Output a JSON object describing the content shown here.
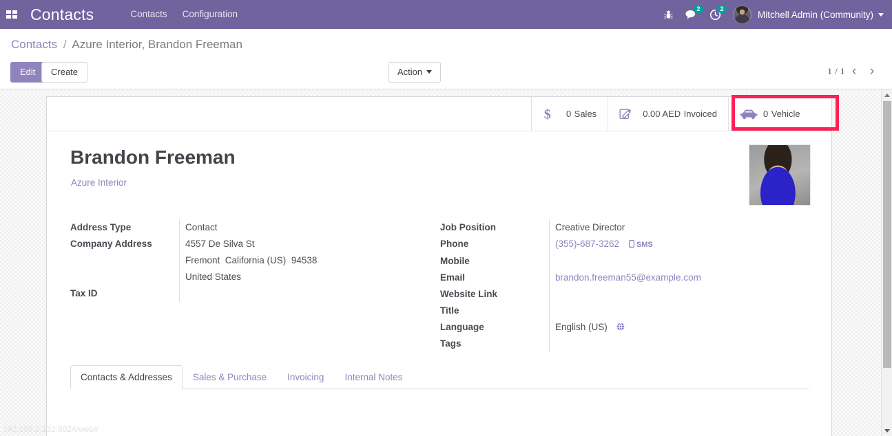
{
  "navbar": {
    "apps_icon": "apps-grid-icon",
    "brand": "Contacts",
    "menus": [
      {
        "label": "Contacts"
      },
      {
        "label": "Configuration"
      }
    ],
    "systray": [
      {
        "name": "debug-bug-icon",
        "badge": ""
      },
      {
        "name": "messages-icon",
        "badge": "2"
      },
      {
        "name": "activities-clock-icon",
        "badge": "2"
      }
    ],
    "user_name": "Mitchell Admin (Community)",
    "brand_color": "#71639e",
    "badge_color": "#00a09d"
  },
  "control_panel": {
    "breadcrumb": {
      "root": "Contacts",
      "separator": "/",
      "current": "Azure Interior, Brandon Freeman"
    },
    "buttons": {
      "edit": "Edit",
      "create": "Create",
      "action": "Action"
    },
    "pager": {
      "value": "1 / 1",
      "prev_icon": "chevron-left-icon",
      "next_icon": "chevron-right-icon"
    }
  },
  "stat_buttons": [
    {
      "icon": "dollar-sign-icon",
      "value": "0",
      "label": "Sales",
      "highlighted": false
    },
    {
      "icon": "pencil-invoice-icon",
      "value": "0.00 AED",
      "label": "Invoiced",
      "highlighted": false
    },
    {
      "icon": "car-icon",
      "value": "0",
      "label": "Vehicle",
      "highlighted": true
    }
  ],
  "highlight": {
    "color": "#fb2056"
  },
  "record": {
    "title": "Brandon Freeman",
    "parent_company": "Azure Interior",
    "photo": "contact-avatar-photo"
  },
  "fields_left": {
    "address_type": {
      "label": "Address Type",
      "value": "Contact"
    },
    "company_address": {
      "label": "Company Address",
      "street": "4557 De Silva St",
      "city": "Fremont",
      "state": "California (US)",
      "zip": "94538",
      "country": "United States"
    },
    "tax_id": {
      "label": "Tax ID",
      "value": ""
    }
  },
  "fields_right": {
    "job_position": {
      "label": "Job Position",
      "value": "Creative Director"
    },
    "phone": {
      "label": "Phone",
      "value": "(355)-687-3262",
      "sms_label": "SMS",
      "sms_icon": "mobile-phone-icon"
    },
    "mobile": {
      "label": "Mobile",
      "value": ""
    },
    "email": {
      "label": "Email",
      "value": "brandon.freeman55@example.com"
    },
    "website_link": {
      "label": "Website Link",
      "value": ""
    },
    "title": {
      "label": "Title",
      "value": ""
    },
    "language": {
      "label": "Language",
      "value": "English (US)",
      "icon": "globe-icon"
    },
    "tags": {
      "label": "Tags",
      "value": ""
    }
  },
  "notebook": {
    "tabs": [
      {
        "label": "Contacts & Addresses",
        "active": true
      },
      {
        "label": "Sales & Purchase",
        "active": false
      },
      {
        "label": "Invoicing",
        "active": false
      },
      {
        "label": "Internal Notes",
        "active": false
      }
    ]
  },
  "status_bar": {
    "url": "192.168.2.132:8024/web#"
  },
  "scrollbar": {
    "up_icon": "triangle-up-icon",
    "down_icon": "triangle-down-icon"
  }
}
